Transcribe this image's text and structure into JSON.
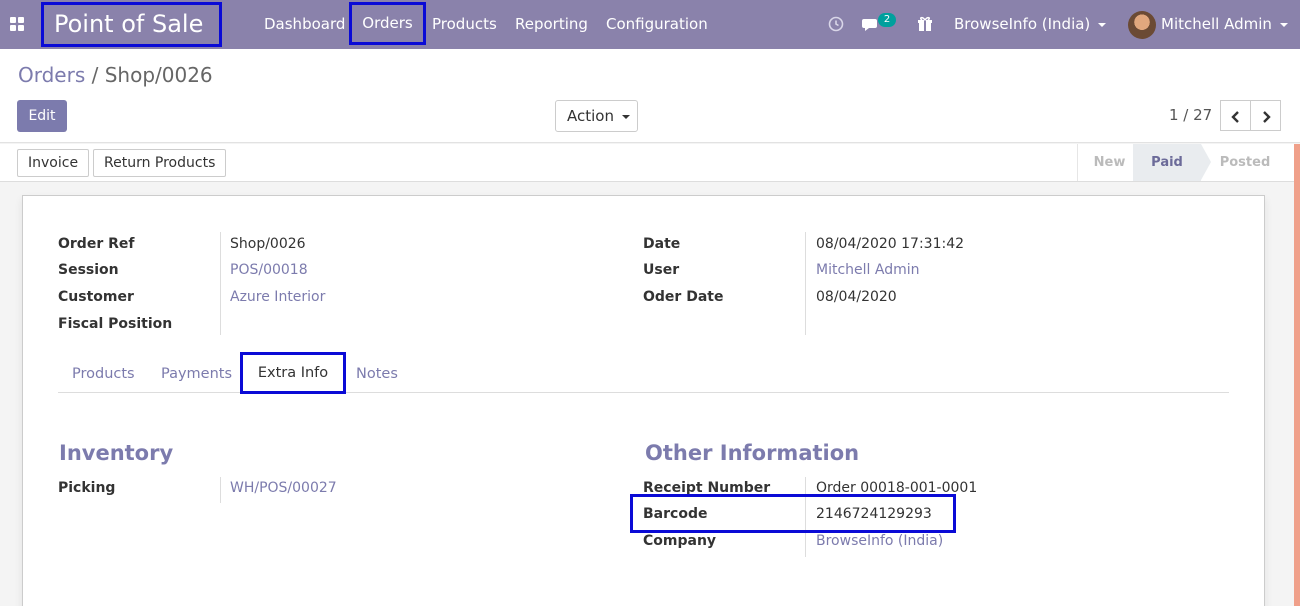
{
  "navbar": {
    "brand": "Point of Sale",
    "menu": [
      "Dashboard",
      "Orders",
      "Products",
      "Reporting",
      "Configuration"
    ],
    "messages_badge": "2",
    "company": "BrowseInfo (India)",
    "user": "Mitchell Admin",
    "icons": [
      "apps-icon",
      "clock-icon",
      "chat-icon",
      "gift-icon"
    ]
  },
  "control_panel": {
    "breadcrumb_parent": "Orders",
    "breadcrumb_sep": " / ",
    "breadcrumb_current": "Shop/0026",
    "edit_label": "Edit",
    "action_label": "Action",
    "pager_value": "1 / 27",
    "prev_icon": "‹",
    "next_icon": "›"
  },
  "statusbar": {
    "buttons": [
      "Invoice",
      "Return Products"
    ],
    "stages": [
      "New",
      "Paid",
      "Posted"
    ],
    "active_stage": "Paid"
  },
  "form": {
    "left_fields": [
      {
        "label": "Order Ref",
        "value": "Shop/0026"
      },
      {
        "label": "Session",
        "value": "POS/00018"
      },
      {
        "label": "Customer",
        "value": "Azure Interior"
      },
      {
        "label": "Fiscal Position",
        "value": ""
      }
    ],
    "right_fields": [
      {
        "label": "Date",
        "value": "08/04/2020 17:31:42"
      },
      {
        "label": "User",
        "value": "Mitchell Admin"
      },
      {
        "label": "Oder Date",
        "value": "08/04/2020"
      }
    ],
    "tabs": [
      "Products",
      "Payments",
      "Extra Info",
      "Notes"
    ],
    "active_tab": "Extra Info",
    "inventory": {
      "title": "Inventory",
      "fields": [
        {
          "label": "Picking",
          "value": "WH/POS/00027"
        }
      ]
    },
    "other_info": {
      "title": "Other Information",
      "fields": [
        {
          "label": "Receipt Number",
          "value": "Order 00018-001-0001"
        },
        {
          "label": "Barcode",
          "value": "2146724129293"
        },
        {
          "label": "Company",
          "value": "BrowseInfo (India)"
        }
      ]
    }
  },
  "colors": {
    "navbar": "#8a82ab",
    "accent": "#7c7bad",
    "highlight_box": "#0a0ad6",
    "badge": "#00a09d"
  }
}
